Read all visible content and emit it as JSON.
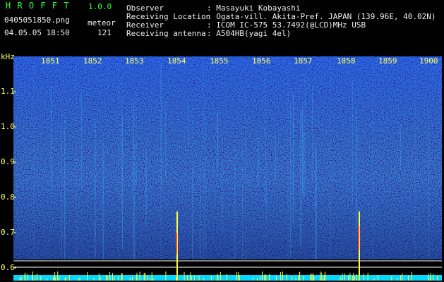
{
  "header": {
    "app_name": "H R O F F T",
    "version": "1.0.0",
    "filename": "0405051850.png",
    "datetime": "04.05.05 18:50",
    "meteor_label": "meteor",
    "meteor_count": "121",
    "info": [
      {
        "label": "Observer",
        "value": ": Masayuki Kobayashi"
      },
      {
        "label": "Receiving Location",
        "value": ": Ogata-vill. Akita-Pref. JAPAN (139.96E, 40.02N)"
      },
      {
        "label": "Receiver",
        "value": ": ICOM IC-575 53.7492(@LCD)MHz USB"
      },
      {
        "label": "Receiving antenna",
        "value": ": A504HB(yagi 4el)"
      }
    ]
  },
  "axis": {
    "y_unit": "kHz",
    "y_labels": [
      "1.1",
      "1.0",
      "0.9",
      "0.8",
      "0.7",
      "0.6"
    ],
    "x_labels": [
      "1851",
      "1852",
      "1853",
      "1854",
      "1855",
      "1856",
      "1857",
      "1858",
      "1859",
      "1900"
    ]
  },
  "colors": {
    "background": "#000000",
    "header_green": "#33ff33",
    "header_white": "#f0f0f0",
    "tick_yellow": "#ffff33",
    "spectrogram_base": "#0a1d8c",
    "meteor_trace": "#ff4040"
  }
}
